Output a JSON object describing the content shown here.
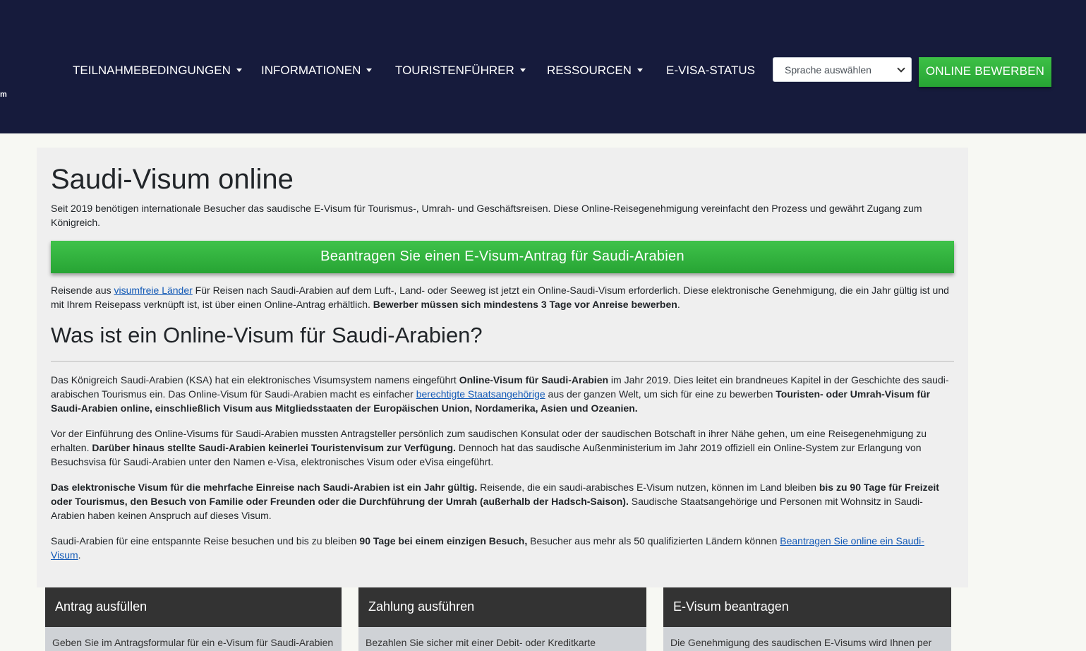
{
  "header": {
    "logo_fragment": "m",
    "nav": [
      {
        "label": "TEILNAHMEBEDINGUNGEN",
        "has_dropdown": true
      },
      {
        "label": "INFORMATIONEN",
        "has_dropdown": true
      },
      {
        "label": "TOURISTENFÜHRER",
        "has_dropdown": true
      },
      {
        "label": "RESSOURCEN",
        "has_dropdown": true
      },
      {
        "label": "E-VISA-STATUS",
        "has_dropdown": false
      }
    ],
    "language_select": {
      "selected": "Sprache auswählen"
    },
    "apply_button": "ONLINE BEWERBEN"
  },
  "main": {
    "title": "Saudi-Visum online",
    "intro": "Seit 2019 benötigen internationale Besucher das saudische E-Visum für Tourismus-, Umrah- und Geschäftsreisen. Diese Online-Reisegenehmigung vereinfacht den Prozess und gewährt Zugang zum Königreich.",
    "cta_button": "Beantragen Sie einen E-Visum-Antrag für Saudi-Arabien",
    "para1": {
      "t1": "Reisende aus ",
      "link": "visumfreie Länder",
      "t2": " Für Reisen nach Saudi-Arabien auf dem Luft-, Land- oder Seeweg ist jetzt ein Online-Saudi-Visum erforderlich. Diese elektronische Genehmigung, die ein Jahr gültig ist und mit Ihrem Reisepass verknüpft ist, ist über einen Online-Antrag erhältlich. ",
      "b1": "Bewerber müssen sich mindestens 3 Tage vor Anreise bewerben",
      "t3": "."
    },
    "section_title": "Was ist ein Online-Visum für Saudi-Arabien?",
    "para2": {
      "t1": "Das Königreich Saudi-Arabien (KSA) hat ein elektronisches Visumsystem namens eingeführt ",
      "b1": "Online-Visum für Saudi-Arabien",
      "t2": " im Jahr 2019. Dies leitet ein brandneues Kapitel in der Geschichte des saudi-arabischen Tourismus ein. Das Online-Visum für Saudi-Arabien macht es einfacher ",
      "link": "berechtigte Staatsangehörige",
      "t3": " aus der ganzen Welt, um sich für eine zu bewerben ",
      "b2": "Touristen- oder Umrah-Visum für Saudi-Arabien online, einschließlich Visum aus Mitgliedsstaaten der Europäischen Union, Nordamerika, Asien und Ozeanien."
    },
    "para3": {
      "t1": "Vor der Einführung des Online-Visums für Saudi-Arabien mussten Antragsteller persönlich zum saudischen Konsulat oder der saudischen Botschaft in ihrer Nähe gehen, um eine Reisegenehmigung zu erhalten. ",
      "b1": "Darüber hinaus stellte Saudi-Arabien keinerlei Touristenvisum zur Verfügung.",
      "t2": " Dennoch hat das saudische Außenministerium im Jahr 2019 offiziell ein Online-System zur Erlangung von Besuchsvisa für Saudi-Arabien unter den Namen e-Visa, elektronisches Visum oder eVisa eingeführt."
    },
    "para4": {
      "b1": "Das elektronische Visum für die mehrfache Einreise nach Saudi-Arabien ist ein Jahr gültig.",
      "t1": " Reisende, die ein saudi-arabisches E-Visum nutzen, können im Land bleiben ",
      "b2": "bis zu 90 Tage für Freizeit oder Tourismus, den Besuch von Familie oder Freunden oder die Durchführung der Umrah (außerhalb der Hadsch-Saison).",
      "t2": " Saudische Staatsangehörige und Personen mit Wohnsitz in Saudi-Arabien haben keinen Anspruch auf dieses Visum."
    },
    "para5": {
      "t1": "Saudi-Arabien für eine entspannte Reise besuchen und bis zu bleiben ",
      "b1": "90 Tage bei einem einzigen Besuch,",
      "t2": " Besucher aus mehr als 50 qualifizierten Ländern können ",
      "link": "Beantragen Sie online ein Saudi-Visum",
      "t3": "."
    }
  },
  "steps": [
    {
      "title": "Antrag ausfüllen",
      "text": "Geben Sie im Antragsformular für ein e-Visum für Saudi-Arabien"
    },
    {
      "title": "Zahlung ausführen",
      "text": "Bezahlen Sie sicher mit einer Debit- oder Kreditkarte"
    },
    {
      "title": "E-Visum beantragen",
      "text": "Die Genehmigung des saudischen E-Visums wird Ihnen per"
    }
  ]
}
